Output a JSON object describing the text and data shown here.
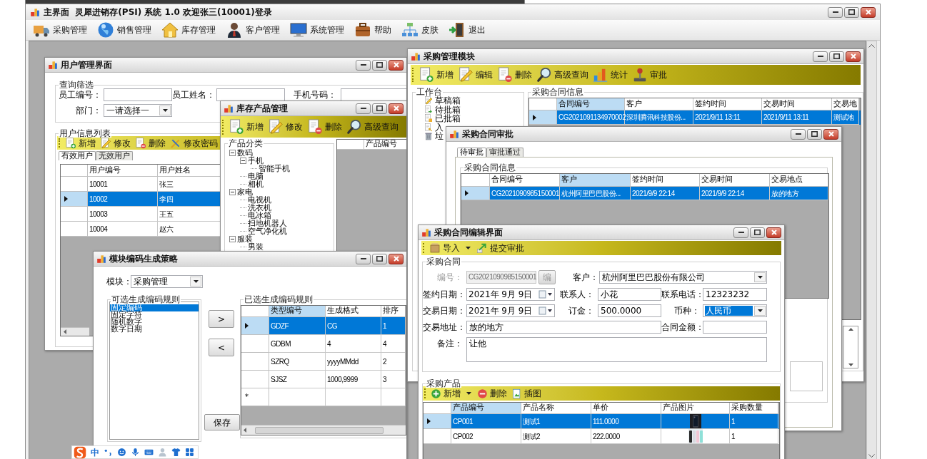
{
  "main_window": {
    "title": "主界面  灵犀进销存(PSI) 系统 1.0 欢迎张三(10001)登录",
    "menu": [
      "采购管理",
      "销售管理",
      "库存管理",
      "客户管理",
      "系统管理",
      "帮助",
      "皮肤",
      "退出"
    ]
  },
  "user_window": {
    "title": "用户管理界面",
    "filter_group": "查询筛选",
    "filters": [
      {
        "label": "员工编号："
      },
      {
        "label": "员工姓名："
      },
      {
        "label": "手机号码："
      }
    ],
    "department": {
      "label": "部门：",
      "value": "一请选择一"
    },
    "list_group": "用户信息列表",
    "toolbar": [
      "新增",
      "修改",
      "删除",
      "修改密码"
    ],
    "tabs": [
      {
        "label": "有效用户",
        "selected": true
      },
      {
        "label": "无效用户",
        "selected": false
      }
    ],
    "table": {
      "columns": [
        {
          "label": "用户编号",
          "highlighted": false
        },
        {
          "label": "用户姓名",
          "highlighted": false
        }
      ],
      "rows": [
        {
          "cells": [
            "10001",
            "张三"
          ],
          "selected": false
        },
        {
          "cells": [
            "10002",
            "李四"
          ],
          "selected": true
        },
        {
          "cells": [
            "10003",
            "王五"
          ],
          "selected": false
        },
        {
          "cells": [
            "10004",
            "赵六"
          ],
          "selected": false
        }
      ]
    }
  },
  "inventory_window": {
    "title": "库存产品管理",
    "toolbar": [
      "新增",
      "修改",
      "删除",
      "高级查询"
    ],
    "tree_group": "产品分类",
    "tree": [
      {
        "label": "数码",
        "expanded": true,
        "children": [
          {
            "label": "手机",
            "expanded": true,
            "children": [
              {
                "label": "智能手机"
              }
            ]
          },
          {
            "label": "电脑"
          },
          {
            "label": "相机"
          }
        ]
      },
      {
        "label": "家电",
        "expanded": true,
        "children": [
          {
            "label": "电视机"
          },
          {
            "label": "洗衣机"
          },
          {
            "label": "电冰箱"
          },
          {
            "label": "扫地机器人"
          },
          {
            "label": "空气净化机"
          }
        ]
      },
      {
        "label": "服装",
        "expanded": true,
        "children": [
          {
            "label": "男装"
          }
        ]
      }
    ],
    "table": {
      "columns": [
        {
          "label": "产品编号",
          "highlighted": false
        }
      ]
    }
  },
  "code_rule_window": {
    "title": "模块编码生成策略",
    "module": {
      "label": "模块：",
      "value": "采购管理"
    },
    "available_group": "可选生成编码规则",
    "available_rules": [
      {
        "label": "固定编码",
        "selected": true
      },
      {
        "label": "固定字符",
        "selected": false
      },
      {
        "label": "随机数字",
        "selected": false
      },
      {
        "label": "数字日期",
        "selected": false
      }
    ],
    "add_button": ">",
    "remove_button": "<",
    "save_button": "保存",
    "selected_group": "已选生成编码规则",
    "table": {
      "columns": [
        {
          "label": "类型编号",
          "highlighted": true
        },
        {
          "label": "生成格式",
          "highlighted": false
        },
        {
          "label": "排序",
          "highlighted": false
        }
      ],
      "rows": [
        {
          "cells": [
            "GDZF",
            "CG",
            "1"
          ],
          "selected": true
        },
        {
          "cells": [
            "GDBM",
            "4",
            "4"
          ],
          "selected": false
        },
        {
          "cells": [
            "SZRQ",
            "yyyyMMdd",
            "2"
          ],
          "selected": false
        },
        {
          "cells": [
            "SJSZ",
            "1000,9999",
            "3"
          ],
          "selected": false
        }
      ],
      "new_row_marker": "*"
    }
  },
  "purchase_window": {
    "title": "采购管理模块",
    "toolbar": [
      "新增",
      "编辑",
      "删除",
      "高级查询",
      "统计",
      "审批"
    ],
    "workbench_group": "工作台",
    "workbench": [
      "草稿箱",
      "待批箱",
      "已批箱",
      "入",
      "垃"
    ],
    "contracts_group": "采购合同信息",
    "table": {
      "columns": [
        {
          "label": "合同编号",
          "highlighted": true
        },
        {
          "label": "客户",
          "highlighted": false
        },
        {
          "label": "签约时间",
          "highlighted": false
        },
        {
          "label": "交易时间",
          "highlighted": false
        },
        {
          "label": "交易地",
          "highlighted": false
        }
      ],
      "rows": [
        {
          "cells": [
            "CG2021091134970002",
            "深圳腾讯科技股份...",
            "2021/9/11 13:11",
            "2021/9/11 13:11",
            "测试地"
          ],
          "selected": true
        }
      ]
    }
  },
  "approval_window": {
    "title": "采购合同审批",
    "tabs": [
      {
        "label": "待审批",
        "selected": true
      },
      {
        "label": "审批通过",
        "selected": false
      }
    ],
    "contracts_group": "采购合同信息",
    "table": {
      "columns": [
        {
          "label": "合同编号",
          "highlighted": false
        },
        {
          "label": "客户",
          "highlighted": true
        },
        {
          "label": "签约时间",
          "highlighted": false
        },
        {
          "label": "交易时间",
          "highlighted": false
        },
        {
          "label": "交易地点",
          "highlighted": false
        }
      ],
      "rows": [
        {
          "cells": [
            "CG2021090985150001",
            "杭州阿里巴巴股份...",
            "2021/9/9 22:14",
            "2021/9/9 22:14",
            "放的地方"
          ],
          "selected": true
        }
      ]
    }
  },
  "edit_window": {
    "title": "采购合同编辑界面",
    "toolbar": [
      {
        "label": "导入",
        "dropdown": true
      },
      {
        "label": "提交审批",
        "dropdown": false
      }
    ],
    "contract_group": "采购合同",
    "code": {
      "label": "编号：",
      "value": "CG2021090985150001",
      "disabled": true,
      "button": "编"
    },
    "customer": {
      "label": "客户：",
      "value": "杭州阿里巴巴股份有限公司"
    },
    "sign_date": {
      "label": "签约日期：",
      "value": "2021年 9月 9日"
    },
    "contact": {
      "label": "联系人：",
      "value": "小花"
    },
    "phone": {
      "label": "联系电话：",
      "value": "12323232"
    },
    "trade_date": {
      "label": "交易日期：",
      "value": "2021年 9月 9日"
    },
    "deposit": {
      "label": "订金：",
      "value": "500.0000"
    },
    "currency": {
      "label": "币种：",
      "value": "人民币",
      "text_selected": true
    },
    "address": {
      "label": "交易地址：",
      "value": "放的地方"
    },
    "amount": {
      "label": "合同金额："
    },
    "note": {
      "label": "备注：",
      "value": "让他"
    },
    "products_group": "采购产品",
    "products_toolbar": [
      {
        "label": "新增",
        "dropdown": true
      },
      {
        "label": "删除",
        "dropdown": false
      },
      {
        "label": "插图",
        "dropdown": false
      }
    ],
    "table": {
      "columns": [
        {
          "label": "产品编号",
          "highlighted": true
        },
        {
          "label": "产品名称",
          "highlighted": false
        },
        {
          "label": "单价",
          "highlighted": false
        },
        {
          "label": "产品图片",
          "highlighted": false
        },
        {
          "label": "采购数量",
          "highlighted": false
        }
      ],
      "rows": [
        {
          "code": "CP001",
          "name": "测试1",
          "price": "111.0000",
          "quantity": "1",
          "selected": true
        },
        {
          "code": "CP002",
          "name": "测试2",
          "price": "222.0000",
          "quantity": "1",
          "selected": false
        }
      ]
    }
  },
  "ime_bar": {
    "label": "中"
  }
}
